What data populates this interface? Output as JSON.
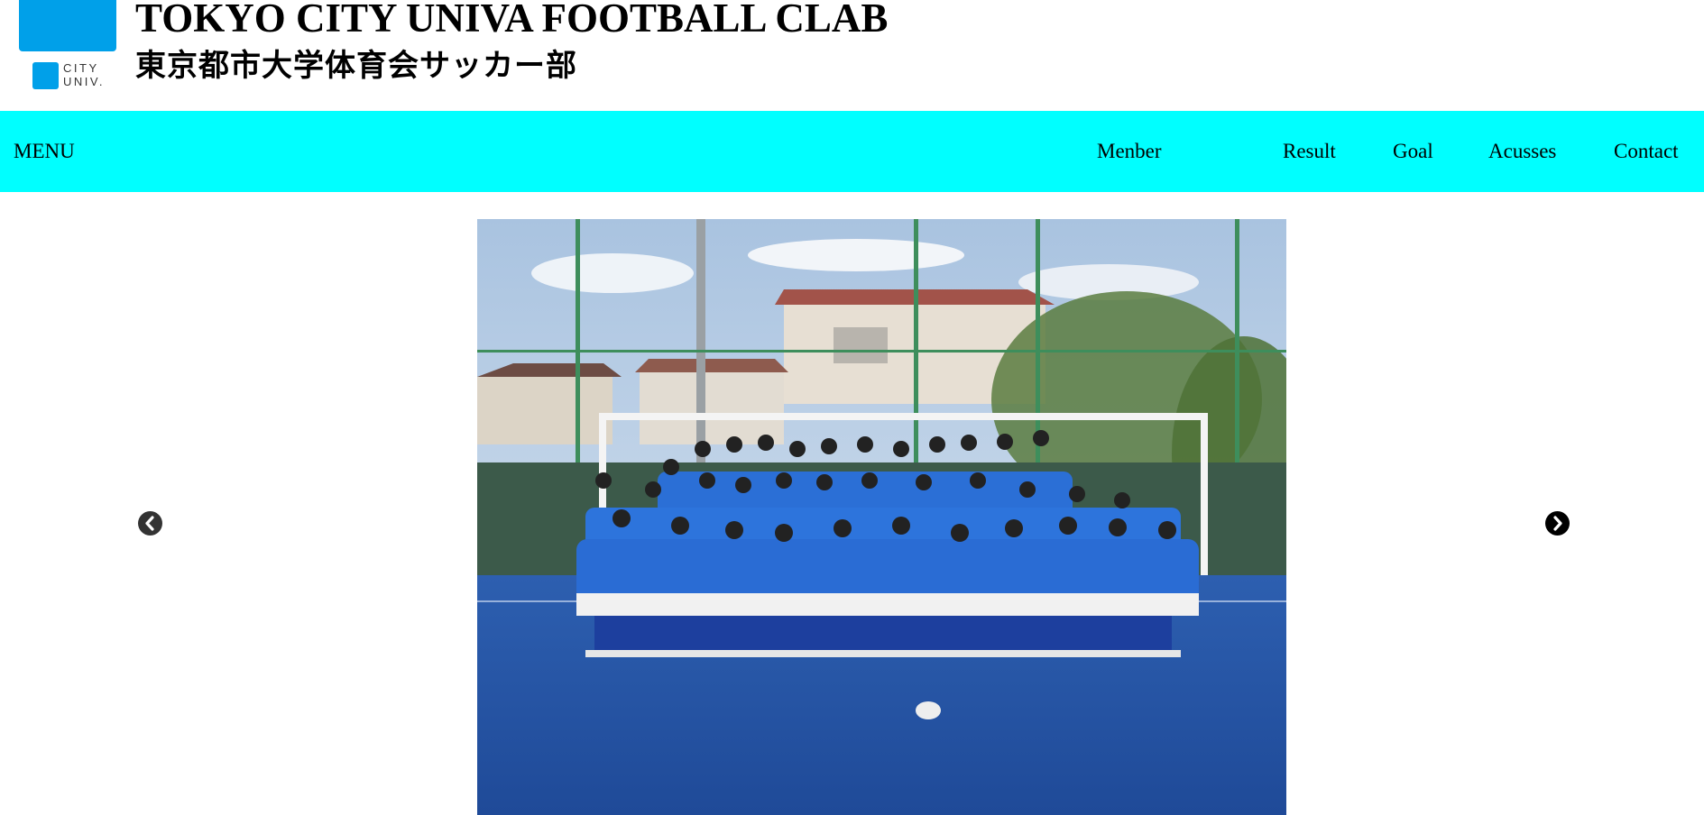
{
  "header": {
    "logo_text_line1": "CITY",
    "logo_text_line2": "UNIV.",
    "title_en": "TOKYO CITY UNIVA FOOTBALL CLAB",
    "title_ja": "東京都市大学体育会サッカー部"
  },
  "nav": {
    "menu_label": "MENU",
    "items": [
      "Menber",
      "Result",
      "Goal",
      "Acusses",
      "Contact"
    ],
    "background": "#00ffff"
  },
  "carousel": {
    "prev_icon": "chevron-left-circle-icon",
    "next_icon": "chevron-right-circle-icon"
  },
  "colors": {
    "brand_blue": "#00a0e9",
    "nav_cyan": "#00ffff"
  }
}
